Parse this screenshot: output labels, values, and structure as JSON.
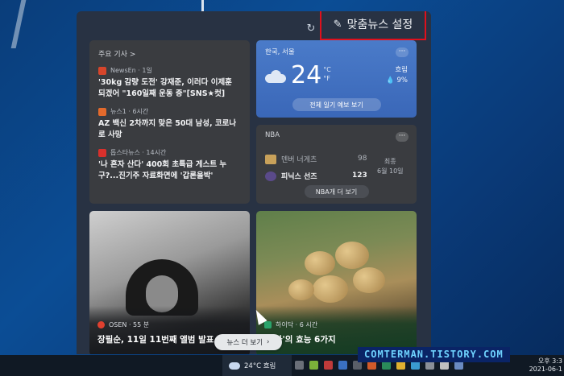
{
  "panel": {
    "settings_label": "맞춤뉴스 설정",
    "more_news_label": "뉴스 더 보기"
  },
  "top_news": {
    "heading": "주요 기사 >",
    "items": [
      {
        "source": "NewsEn · 1일",
        "headline": "'30kg 감량 도전' 강재준, 이러다 이제훈 되겠어 \"160일째 운동 중\"[SNS★컷]"
      },
      {
        "source": "뉴스1 · 6시간",
        "headline": "AZ 백신 2차까지 맞은 50대 남성, 코로나로 사망"
      },
      {
        "source": "톱스타뉴스 · 14시간",
        "headline": "'나 혼자 산다' 400회 초특급 게스트 누구?...진기주 자료화면에 '갑론을박'"
      }
    ]
  },
  "weather": {
    "location": "한국, 서울",
    "temp": "24",
    "unit_c": "°C",
    "unit_f": "°F",
    "condition": "흐림",
    "precip": "💧 9%",
    "forecast_button": "전체 일기 예보 보기"
  },
  "nba": {
    "title": "NBA",
    "team1": "덴버 너게츠",
    "team1_score": "98",
    "team2": "피닉스 선즈",
    "team2_score": "123",
    "status_line1": "최종",
    "status_line2": "6월 10일",
    "more_button": "NBA개 더 보기"
  },
  "photo_cards": [
    {
      "source": "OSEN · 55 분",
      "title": "장필순, 11일 11번째 앨범 발표 [공식]"
    },
    {
      "source": "하이닥 · 6 시간",
      "title": "'감자'의 효능 6가지"
    }
  ],
  "taskbar": {
    "weather": "24°C  흐림",
    "time": "오후 3:3",
    "date": "2021-06-1"
  },
  "watermark": "COMTERMAN.TISTORY.COM"
}
